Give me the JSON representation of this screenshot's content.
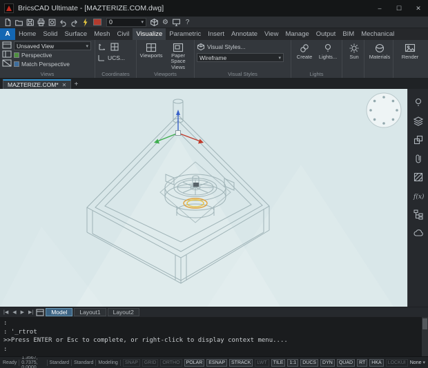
{
  "window": {
    "title": "BricsCAD Ultimate - [MAZTERIZE.COM.dwg]",
    "minimize": "–",
    "maximize": "☐",
    "close": "✕"
  },
  "qat": {
    "icons": [
      "new-document",
      "open",
      "save",
      "print",
      "print-preview",
      "undo",
      "redo",
      "lightning",
      "color-swatch",
      "layer-select",
      "cube",
      "settings-gear",
      "monitor",
      "help"
    ],
    "swatch_color": "#b23b2e",
    "layer_value": "0"
  },
  "ribbon": {
    "tabs": [
      "Home",
      "Solid",
      "Surface",
      "Mesh",
      "Civil",
      "Visualize",
      "Parametric",
      "Insert",
      "Annotate",
      "View",
      "Manage",
      "Output",
      "BIM",
      "Mechanical"
    ],
    "active_tab": "Visualize",
    "views": {
      "label": "Views",
      "view_select": "Unsaved View",
      "perspective": "Perspective",
      "match_perspective": "Match Perspective"
    },
    "coordinates": {
      "label": "Coordinates",
      "ucs": "UCS..."
    },
    "viewports": {
      "label": "Viewports",
      "viewports_btn": "Viewports",
      "paper_space_btn": "Paper Space Views"
    },
    "visual_styles": {
      "label": "Visual Styles",
      "styles_btn": "Visual Styles...",
      "style_select": "Wireframe"
    },
    "lights": {
      "label": "Lights",
      "create_btn": "Create",
      "lights_btn": "Lights...",
      "sun_btn": "Sun"
    },
    "materials_btn": "Materials",
    "render_btn": "Render"
  },
  "doc_tabs": {
    "active_tab": "MAZTERIZE.COM*",
    "close": "✕",
    "new_tab": "+"
  },
  "viewport": {
    "background": "#d9e7e9",
    "wireframe_color": "#9fb3b7",
    "highlight_color": "#e2a23b",
    "axis_x_color": "#c03a2b",
    "axis_y_color": "#3fae4e",
    "axis_z_color": "#3a62c8"
  },
  "sidebar_icons": [
    "lightbulb",
    "layers",
    "stack",
    "paperclip",
    "hatch",
    "function",
    "hierarchy",
    "cloud"
  ],
  "layout_bar": {
    "nav": [
      "|◀",
      "◀",
      "▶",
      "▶|"
    ],
    "tabs": [
      "Model",
      "Layout1",
      "Layout2"
    ],
    "active": "Model"
  },
  "command": {
    "lines": [
      ":",
      ": '_rtrot",
      ">>Press ENTER or Esc to complete, or right-click to display context menu....",
      ":"
    ]
  },
  "status": {
    "ready": "Ready",
    "coords": "1.3567, 0.7375, 0.0000",
    "style": "Standard",
    "annotation_scale": "Standard",
    "workspace": "Modeling",
    "toggles": [
      {
        "label": "SNAP",
        "active": false
      },
      {
        "label": "GRID",
        "active": false
      },
      {
        "label": "ORTHO",
        "active": false
      },
      {
        "label": "POLAR",
        "active": true
      },
      {
        "label": "ESNAP",
        "active": true
      },
      {
        "label": "STRACK",
        "active": true
      },
      {
        "label": "LWT",
        "active": false
      },
      {
        "label": "TILE",
        "active": true
      },
      {
        "label": "1:1",
        "active": true
      },
      {
        "label": "DUCS",
        "active": true
      },
      {
        "label": "DYN",
        "active": true
      },
      {
        "label": "QUAD",
        "active": true
      },
      {
        "label": "RT",
        "active": true
      },
      {
        "label": "HKA",
        "active": true
      },
      {
        "label": "LOCKUI",
        "active": false
      }
    ],
    "selection_mode": "None",
    "selection_caret": "▾"
  }
}
